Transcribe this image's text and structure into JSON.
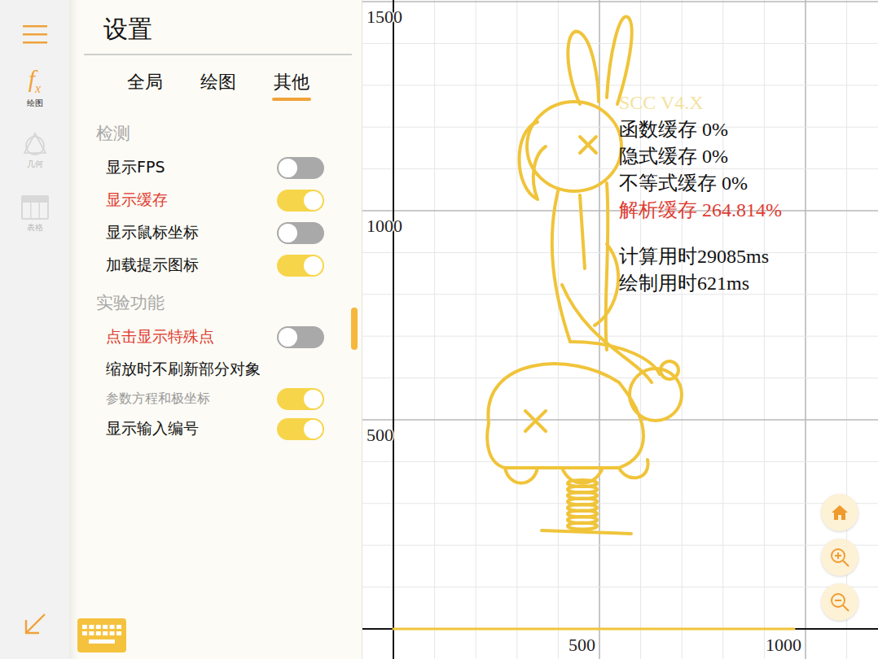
{
  "rail": {
    "items": [
      {
        "label": "绘图",
        "kind": "fx",
        "icon_text": "f",
        "icon_sub": "x",
        "selected": true,
        "disabled": false
      },
      {
        "label": "几何",
        "kind": "geometry",
        "selected": false,
        "disabled": true
      },
      {
        "label": "表格",
        "kind": "table",
        "selected": false,
        "disabled": true
      }
    ]
  },
  "settings": {
    "title": "设置",
    "tabs": [
      {
        "label": "全局",
        "selected": false
      },
      {
        "label": "绘图",
        "selected": false
      },
      {
        "label": "其他",
        "selected": true
      }
    ],
    "sections": [
      {
        "title": "检测",
        "items": [
          {
            "label": "显示FPS",
            "kind": "toggle",
            "on": false,
            "highlighted": false
          },
          {
            "label": "显示缓存",
            "kind": "toggle",
            "on": true,
            "highlighted": true
          },
          {
            "label": "显示鼠标坐标",
            "kind": "toggle",
            "on": false,
            "highlighted": false
          },
          {
            "label": "加载提示图标",
            "kind": "toggle",
            "on": true,
            "highlighted": false
          }
        ]
      },
      {
        "title": "实验功能",
        "items": [
          {
            "label": "点击显示特殊点",
            "kind": "toggle",
            "on": false,
            "highlighted": true
          },
          {
            "label": "缩放时不刷新部分对象",
            "kind": "label",
            "on": false,
            "highlighted": false
          },
          {
            "label": "参数方程和极坐标",
            "kind": "sub",
            "on": true,
            "highlighted": false
          },
          {
            "label": "显示输入编号",
            "kind": "toggle",
            "on": true,
            "highlighted": false
          }
        ]
      }
    ]
  },
  "graph": {
    "x_ticks": [
      {
        "label": "500",
        "value": 500
      },
      {
        "label": "1000",
        "value": 1000
      }
    ],
    "y_ticks": [
      {
        "label": "1500",
        "value": 1500
      },
      {
        "label": "1000",
        "value": 1000
      },
      {
        "label": "500",
        "value": 500
      }
    ],
    "overlay": {
      "title": "SCC V4.X",
      "cache_lines": [
        {
          "text": "函数缓存 0%",
          "highlighted": false
        },
        {
          "text": "隐式缓存 0%",
          "highlighted": false
        },
        {
          "text": "不等式缓存 0%",
          "highlighted": false
        },
        {
          "text": "解析缓存 264.814%",
          "highlighted": true
        }
      ],
      "time_lines": [
        {
          "text": "计算用时29085ms"
        },
        {
          "text": "绘制用时621ms"
        }
      ]
    }
  }
}
